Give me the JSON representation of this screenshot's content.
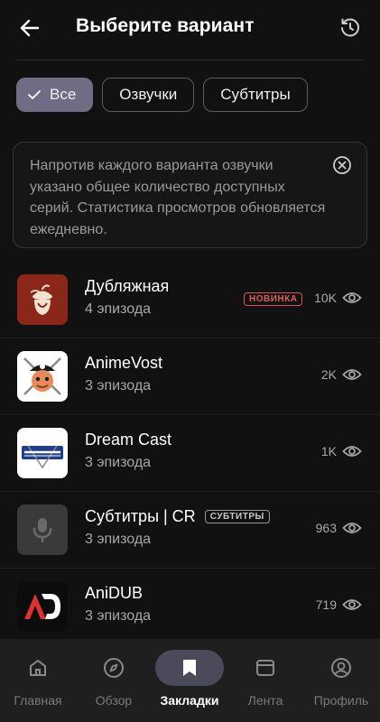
{
  "header": {
    "title": "Выберите вариант"
  },
  "filters": {
    "chips": [
      "Все",
      "Озвучки",
      "Субтитры"
    ],
    "active_index": 0
  },
  "notice": {
    "text": "Напротив каждого варианта озвучки указано общее количество доступных серий. Статистика просмотров обновляется ежедневно."
  },
  "variants": [
    {
      "name": "Дубляжная",
      "episodes": "4 эпизода",
      "badge": "НОВИНКА",
      "views": "10K",
      "thumb": "acorn-logo"
    },
    {
      "name": "AnimeVost",
      "episodes": "3 эпизода",
      "badge": "",
      "views": "2K",
      "thumb": "pirate-logo"
    },
    {
      "name": "Dream Cast",
      "episodes": "3 эпизода",
      "badge": "",
      "views": "1K",
      "thumb": "dreamcast-logo"
    },
    {
      "name": "Субтитры | CR",
      "episodes": "3 эпизода",
      "badge": "СУБТИТРЫ",
      "views": "963",
      "thumb": "microphone-icon"
    },
    {
      "name": "AniDUB",
      "episodes": "3 эпизода",
      "badge": "",
      "views": "719",
      "thumb": "anidub-logo"
    }
  ],
  "nav": {
    "items": [
      {
        "label": "Главная",
        "icon": "home-icon"
      },
      {
        "label": "Обзор",
        "icon": "compass-icon"
      },
      {
        "label": "Закладки",
        "icon": "bookmark-icon"
      },
      {
        "label": "Лента",
        "icon": "feed-icon"
      },
      {
        "label": "Профиль",
        "icon": "profile-icon"
      }
    ],
    "active_index": 2
  },
  "colors": {
    "background": "#111111",
    "chip_active": "#6e6d83",
    "badge_new": "#e06060",
    "nav_active_pill": "#4b4a5a",
    "thumb_dub": "#8a2718"
  }
}
